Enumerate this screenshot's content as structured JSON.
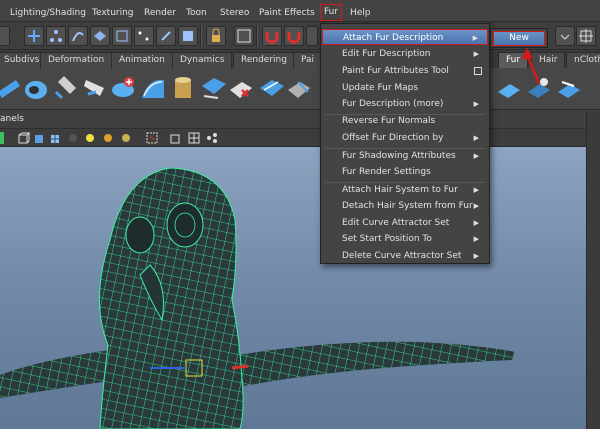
{
  "menubar": {
    "items": [
      "Lighting/Shading",
      "Texturing",
      "Render",
      "Toon",
      "Stereo",
      "Paint Effects",
      "Fur",
      "Help"
    ]
  },
  "shelf": {
    "tabs": [
      "Subdivs",
      "Deformation",
      "Animation",
      "Dynamics",
      "Rendering",
      "Pai",
      "Fur",
      "Hair",
      "nCloth"
    ]
  },
  "panel": {
    "label": "anels"
  },
  "fur_menu": {
    "items": [
      "Attach Fur Description",
      "Edit Fur Description",
      "Paint Fur Attributes Tool",
      "Update Fur Maps",
      "Fur Description (more)",
      "Reverse Fur Normals",
      "Offset Fur Direction by",
      "Fur Shadowing Attributes",
      "Fur Render Settings",
      "Attach Hair System to Fur",
      "Detach Hair System from Fur",
      "Edit Curve Attractor Set",
      "Set Start Position To",
      "Delete Curve Attractor Set"
    ],
    "submenu_new": "New"
  },
  "colors": {
    "highlight": "#4a73ad",
    "annotation_red": "#d21a1a",
    "wireframe": "#3cf0a0"
  }
}
